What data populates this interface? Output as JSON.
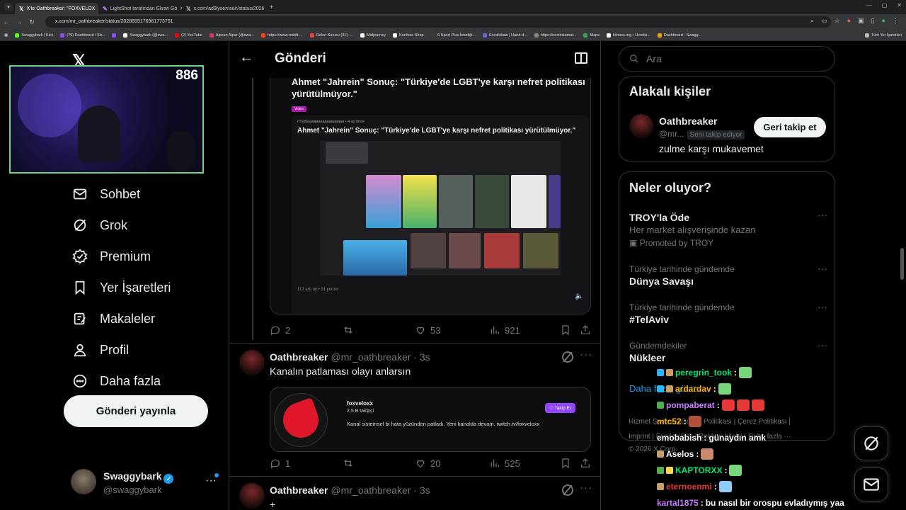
{
  "browser": {
    "tabs": [
      {
        "label": "X'te Oathbreaker: \"FOXVELOX",
        "active": true
      },
      {
        "label": "LightShot tarafından Ekran Gö",
        "active": false
      },
      {
        "label": "x.com/ad9lysemseir/status/2026",
        "active": false
      }
    ],
    "url": "x.com/mr_oathbreaker/status/2028555176961773751",
    "bookmarks": [
      {
        "label": "Swaggybark | Kick",
        "color": "#53fc18"
      },
      {
        "label": "(79) Dashboard / Str...",
        "color": "#9146ff"
      },
      {
        "label": "",
        "color": "#9146ff"
      },
      {
        "label": "Swaggybark (@swa...",
        "color": "#ffffff"
      },
      {
        "label": "(2) YouTube",
        "color": "#ff0000"
      },
      {
        "label": "Alpcan Alpar (@swa...",
        "color": "#e1306c"
      },
      {
        "label": "https://www.reddit....",
        "color": "#ff4500"
      },
      {
        "label": "Gelen Kutusu (31) -...",
        "color": "#ea4335"
      },
      {
        "label": "Midjourney",
        "color": "#ffffff"
      },
      {
        "label": "Konfuse Shop",
        "color": "#ffffff"
      },
      {
        "label": "S Sport Plus-İstediği...",
        "color": "#3a3a3a"
      },
      {
        "label": "Excalidraw | Hand-d...",
        "color": "#6965db"
      },
      {
        "label": "https://nextinkamat...",
        "color": "#888888"
      },
      {
        "label": "Maps",
        "color": "#34a853"
      },
      {
        "label": "lichess.org • Ücretsi...",
        "color": "#ffffff"
      },
      {
        "label": "Dashboard - Swagg...",
        "color": "#f0a500"
      }
    ],
    "bookmarks_all": "Tüm Yer İşaretleri"
  },
  "stream": {
    "viewer_count": "886"
  },
  "leftnav": {
    "items": [
      {
        "label": "Sohbet",
        "icon": "mail-icon"
      },
      {
        "label": "Grok",
        "icon": "grok-icon"
      },
      {
        "label": "Premium",
        "icon": "premium-icon"
      },
      {
        "label": "Yer İşaretleri",
        "icon": "bookmark-icon"
      },
      {
        "label": "Makaleler",
        "icon": "article-icon"
      },
      {
        "label": "Profil",
        "icon": "profile-icon"
      },
      {
        "label": "Daha fazla",
        "icon": "more-icon"
      }
    ],
    "post_button": "Gönderi yayınla",
    "account": {
      "name": "Swaggybark",
      "handle": "@swaggybark"
    }
  },
  "center": {
    "header_title": "Gönderi",
    "quoted": {
      "title": "Ahmet \"Jahrein\" Sonuç: \"Türkiye'de LGBT'ye karşı nefret politikası yürütülmüyor.\"",
      "tag": "Video",
      "sub": "r/Turkaaaaaaaaaaaaaaaaa • 4 ay önce",
      "inner_title": "Ahmet \"Jahrein\" Sonuç: \"Türkiye'de LGBT'ye karşı nefret politikası yürütülmüyor.\"",
      "meta": "112 artı oy  •  91 yorum"
    },
    "actions1": {
      "replies": "2",
      "likes": "53",
      "views": "921"
    },
    "post2": {
      "name": "Oathbreaker",
      "handle": "@mr_oathbreaker · 3s",
      "text": "Kanalın patlaması olayı anlarsın",
      "card": {
        "name": "foxveloxx",
        "followers": "2,5 B takipçi",
        "desc": "Kanal sistemsel bi hata yüzünden patladı. Yeni kanalda devam. twitch.tv/foxveloxx",
        "follow": "Takip Et"
      },
      "replies": "1",
      "likes": "20",
      "views": "525"
    },
    "post3": {
      "name": "Oathbreaker",
      "handle": "@mr_oathbreaker · 3s",
      "text": "+"
    }
  },
  "right": {
    "search_placeholder": "Ara",
    "related_title": "Alakalı kişiler",
    "related": {
      "name": "Oathbreaker",
      "handle": "@mr...",
      "follows_you": "Seni takip ediyor",
      "button": "Geri takip et",
      "bio": "zulme karşı mukavemet"
    },
    "trends_title": "Neler oluyor?",
    "trends": [
      {
        "context": "",
        "title": "TROY'la Öde",
        "sub": "Her market alışverişinde kazan",
        "promo": "Promoted by TROY"
      },
      {
        "context": "Türkiye tarihinde gündemde",
        "title": "Dünya Savaşı",
        "sub": "",
        "promo": ""
      },
      {
        "context": "Türkiye tarihinde gündemde",
        "title": "#TelAviv",
        "sub": "",
        "promo": ""
      },
      {
        "context": "Gündemdekiler",
        "title": "Nükleer",
        "sub": "",
        "promo": ""
      }
    ],
    "show_more": "Daha fazla göster",
    "footer": {
      "line1": "Hizmet Şartları  |  Gizlilik Politikası  |  Çerez Politikası  |",
      "line2": "Imprint  |  Erişilebilirlik  |  Reklam bilgisi  |  Daha fazla ···",
      "line3": "© 2026 X Corp."
    }
  },
  "chat": [
    {
      "user": "peregrin_took",
      "color": "#00e676",
      "text": "",
      "badges": [
        "#29b6f6",
        "#c8a165"
      ],
      "emotes": [
        "#7ad67a"
      ]
    },
    {
      "user": "ardardav",
      "color": "#ffb300",
      "text": "",
      "badges": [
        "#29b6f6",
        "#c8a165"
      ],
      "emotes": [
        "#7ad67a"
      ]
    },
    {
      "user": "pompaberat",
      "color": "#c77dff",
      "text": "",
      "badges": [
        "#4caf50"
      ],
      "emotes": [
        "#e53935",
        "#e53935",
        "#e53935"
      ]
    },
    {
      "user": "mtc52",
      "color": "#ffb300",
      "text": "",
      "badges": [],
      "emotes": [
        "#b0503a"
      ]
    },
    {
      "user": "emobabish",
      "color": "#ffffff",
      "text": "günaydın amk",
      "badges": [],
      "emotes": []
    },
    {
      "user": "Aselos",
      "color": "#ffffff",
      "text": "",
      "badges": [
        "#c8a165"
      ],
      "emotes": [
        "#c98a6a"
      ]
    },
    {
      "user": "KAPTORXX",
      "color": "#00e676",
      "text": "",
      "badges": [
        "#4caf50",
        "#ffd54f"
      ],
      "emotes": [
        "#7ad67a"
      ]
    },
    {
      "user": "eternoenmi",
      "color": "#e53935",
      "text": "",
      "badges": [
        "#c8a165"
      ],
      "emotes": [
        "#90caf9"
      ]
    },
    {
      "user": "kartal1875",
      "color": "#c77dff",
      "text": "bu nasıl bir orospu evladıymış yaa",
      "badges": [],
      "emotes": []
    }
  ]
}
